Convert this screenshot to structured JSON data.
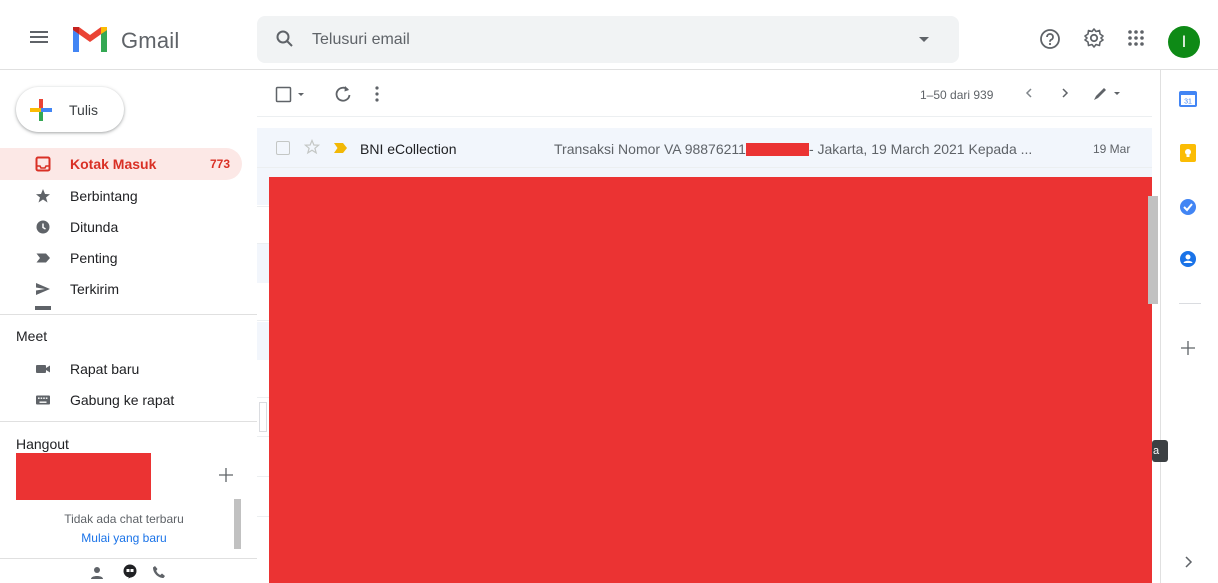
{
  "header": {
    "app_name": "Gmail",
    "search_placeholder": "Telusuri email",
    "avatar_letter": "I"
  },
  "sidebar": {
    "compose_label": "Tulis",
    "items": [
      {
        "label": "Kotak Masuk",
        "count": "773",
        "icon": "inbox-icon",
        "active": true
      },
      {
        "label": "Berbintang",
        "icon": "star-icon"
      },
      {
        "label": "Ditunda",
        "icon": "clock-icon"
      },
      {
        "label": "Penting",
        "icon": "important-icon"
      },
      {
        "label": "Terkirim",
        "icon": "send-icon"
      }
    ],
    "meet": {
      "title": "Meet",
      "items": [
        {
          "label": "Rapat baru",
          "icon": "video-camera-icon"
        },
        {
          "label": "Gabung ke rapat",
          "icon": "keyboard-icon"
        }
      ]
    },
    "hangout": {
      "title": "Hangout",
      "no_chat_text": "Tidak ada chat terbaru",
      "start_new_link": "Mulai yang baru"
    }
  },
  "toolbar": {
    "pagination": "1–50 dari 939"
  },
  "emails": [
    {
      "sender": "BNI eCollection",
      "subject_prefix": "Transaksi Nomor VA 98876211",
      "subject_suffix": "- Jakarta, 19 March 2021 Kepada ...",
      "date": "19 Mar"
    }
  ],
  "tooltip_fragment": "a",
  "colors": {
    "accent_red": "#d93025",
    "active_bg": "#fce8e6",
    "redaction": "#eb3333",
    "avatar_bg": "#0e8a16"
  }
}
